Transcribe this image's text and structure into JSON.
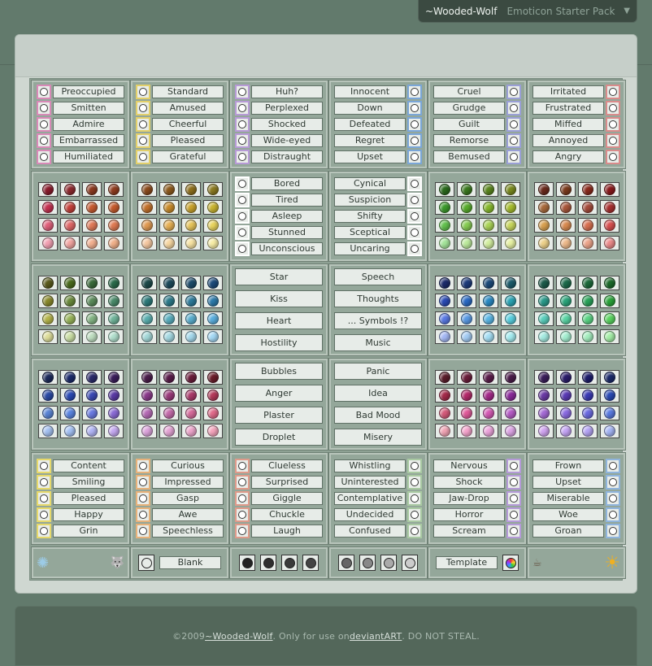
{
  "tab": {
    "user": "~Wooded-Wolf",
    "pack": "Emoticon Starter Pack"
  },
  "rows1": [
    {
      "labels": [
        "Preoccupied",
        "Smitten",
        "Admire",
        "Embarrassed",
        "Humiliated"
      ],
      "side": "left",
      "color": "#d889b7"
    },
    {
      "labels": [
        "Standard",
        "Amused",
        "Cheerful",
        "Pleased",
        "Grateful"
      ],
      "side": "left",
      "color": "#e2cf6a"
    },
    {
      "labels": [
        "Huh?",
        "Perplexed",
        "Shocked",
        "Wide-eyed",
        "Distraught"
      ],
      "side": "left",
      "color": "#b79ad6"
    },
    {
      "labels": [
        "Innocent",
        "Down",
        "Defeated",
        "Regret",
        "Upset"
      ],
      "side": "right",
      "color": "#7aa6d8"
    },
    {
      "labels": [
        "Cruel",
        "Grudge",
        "Guilt",
        "Remorse",
        "Bemused"
      ],
      "side": "right",
      "color": "#9a9fd6"
    },
    {
      "labels": [
        "Irritated",
        "Frustrated",
        "Miffed",
        "Annoyed",
        "Angry"
      ],
      "side": "right",
      "color": "#d98b8b"
    }
  ],
  "rows3": [
    {
      "labels": [
        "Content",
        "Smiling",
        "Pleased",
        "Happy",
        "Grin"
      ],
      "side": "left",
      "color": "#e6d86a"
    },
    {
      "labels": [
        "Curious",
        "Impressed",
        "Gasp",
        "Awe",
        "Speechless"
      ],
      "side": "left",
      "color": "#e6b17a"
    },
    {
      "labels": [
        "Clueless",
        "Surprised",
        "Giggle",
        "Chuckle",
        "Laugh"
      ],
      "side": "left",
      "color": "#de9a8a"
    },
    {
      "labels": [
        "Whistling",
        "Uninterested",
        "Contemplative",
        "Undecided",
        "Confused"
      ],
      "side": "right",
      "color": "#a9c9a2"
    },
    {
      "labels": [
        "Nervous",
        "Shock",
        "Jaw-Drop",
        "Horror",
        "Scream"
      ],
      "side": "right",
      "color": "#b59ad8"
    },
    {
      "labels": [
        "Frown",
        "Upset",
        "Miserable",
        "Woe",
        "Groan"
      ],
      "side": "right",
      "color": "#8fb4dc"
    }
  ],
  "middle": {
    "sleepy": [
      "Bored",
      "Tired",
      "Asleep",
      "Stunned",
      "Unconscious"
    ],
    "sceptic": [
      "Cynical",
      "Suspicion",
      "Shifty",
      "Sceptical",
      "Uncaring"
    ],
    "left_extras": [
      "Star",
      "Kiss",
      "Heart",
      "Hostility",
      "Bubbles",
      "Anger",
      "Plaster",
      "Droplet"
    ],
    "right_extras": [
      "Speech",
      "Thoughts",
      "... Symbols !?",
      "Music",
      "Panic",
      "Idea",
      "Bad Mood",
      "Misery"
    ]
  },
  "orbs": {
    "p1": [
      [
        "#8a1c2c",
        "#8e2a2f",
        "#8c3a20",
        "#8f3c1f"
      ],
      [
        "#c43050",
        "#c4403b",
        "#c65a30",
        "#c55a2c"
      ],
      [
        "#e0607a",
        "#e06868",
        "#e07a58",
        "#de7a52"
      ],
      [
        "#f2a0b2",
        "#f2a4a0",
        "#f2b090",
        "#f0b08a"
      ]
    ],
    "p2": [
      [
        "#8a4a1c",
        "#8d5a1d",
        "#8e6f1c",
        "#8b7a20"
      ],
      [
        "#c2702a",
        "#c88a2a",
        "#c9a22c",
        "#c9b430"
      ],
      [
        "#e09a52",
        "#e6b054",
        "#e6c45a",
        "#e8d45e"
      ],
      [
        "#f4c7a0",
        "#f6d6a0",
        "#f6e2a2",
        "#f6eca6"
      ]
    ],
    "p3": [
      [
        "#2a6a1c",
        "#3a781e",
        "#5a861e",
        "#7a8a1e"
      ],
      [
        "#3c9a2c",
        "#58ac2c",
        "#86b82c",
        "#a6bc2e"
      ],
      [
        "#62c04e",
        "#86cc52",
        "#aad456",
        "#c8d65c"
      ],
      [
        "#a4e49a",
        "#bcea9c",
        "#d2ee9e",
        "#e6f0a2"
      ]
    ],
    "p4": [
      [
        "#6a2a1c",
        "#7a3a1c",
        "#8a2a1c",
        "#8a1a1c"
      ],
      [
        "#a86a3c",
        "#a8563a",
        "#a44a3a",
        "#a83030"
      ],
      [
        "#d8a050",
        "#d88a50",
        "#d87050",
        "#d85050"
      ],
      [
        "#ecd08a",
        "#ecb88a",
        "#eca48a",
        "#ec8a8a"
      ]
    ],
    "p5": [
      [
        "#5a5a1c",
        "#4a6a1c",
        "#3a6a3a",
        "#2a6a4a"
      ],
      [
        "#8a8a2c",
        "#6a8a3c",
        "#5a8a5a",
        "#4a8a6a"
      ],
      [
        "#b4b44a",
        "#98b45a",
        "#84b484",
        "#70b49a"
      ],
      [
        "#dede9a",
        "#cadea4",
        "#bedec0",
        "#b0decc"
      ]
    ],
    "p6": [
      [
        "#1c4a4a",
        "#1c4a5a",
        "#1c4a6a",
        "#1c4a7a"
      ],
      [
        "#2c7a7a",
        "#2c7a8a",
        "#2c7a9a",
        "#2c7aaa"
      ],
      [
        "#5aaeae",
        "#5aaebe",
        "#5aaece",
        "#5aaede"
      ],
      [
        "#a4d8d8",
        "#a4d8e2",
        "#a4d8ec",
        "#a4d8f4"
      ]
    ],
    "p7": [
      [
        "#1c2a6a",
        "#1c3a7a",
        "#1c4a7a",
        "#1c5a6a"
      ],
      [
        "#2a4ab4",
        "#2a6ac4",
        "#2a8ac4",
        "#2aa4b4"
      ],
      [
        "#5a7ae4",
        "#5a9ae4",
        "#5ab6e4",
        "#5ad0e0"
      ],
      [
        "#a4b8f4",
        "#a4ccf4",
        "#a4def4",
        "#a4ecf0"
      ]
    ],
    "p8": [
      [
        "#1c5a4a",
        "#1c6a4a",
        "#1c6a3a",
        "#1c6a2a"
      ],
      [
        "#2a9a8a",
        "#2aa47a",
        "#2aa45a",
        "#2aa43a"
      ],
      [
        "#5acebc",
        "#5ad4a4",
        "#5ad484",
        "#5ad460"
      ],
      [
        "#a4eae0",
        "#a4eed0",
        "#a4eebe",
        "#a4eea6"
      ]
    ],
    "p9": [
      [
        "#1c2a5a",
        "#1c2a6a",
        "#2a2a6a",
        "#3a1c5a"
      ],
      [
        "#2a4aa4",
        "#2a4ab4",
        "#3a4ab4",
        "#5a3aa4"
      ],
      [
        "#5a84d4",
        "#5a84e0",
        "#6a7ae0",
        "#8a6ad4"
      ],
      [
        "#a4c0f0",
        "#a4c0f4",
        "#b0b4f4",
        "#c4a8f0"
      ]
    ],
    "p10": [
      [
        "#4a1c4a",
        "#5a1c4a",
        "#6a1c3a",
        "#6a1c2a"
      ],
      [
        "#8a3a8a",
        "#9a3a7a",
        "#aa3a6a",
        "#b43a5a"
      ],
      [
        "#b46ab4",
        "#c46aaa",
        "#d46a9a",
        "#e06a8a"
      ],
      [
        "#dca4dc",
        "#e4a4d4",
        "#eca4ca",
        "#f4a4bc"
      ]
    ],
    "p11": [
      [
        "#5a1c2a",
        "#6a1c3a",
        "#5a1c4a",
        "#4a1c4a"
      ],
      [
        "#a42a4a",
        "#b42a6a",
        "#a42a8a",
        "#8a2a9a"
      ],
      [
        "#d45a7a",
        "#e05a9a",
        "#d45ab4",
        "#b45ac4"
      ],
      [
        "#f0a4b4",
        "#f4a4cc",
        "#eca4dc",
        "#dca4e4"
      ]
    ],
    "p12": [
      [
        "#3a1c5a",
        "#2a1c6a",
        "#1c1c6a",
        "#1c2a6a"
      ],
      [
        "#6a3aa4",
        "#5a3ab4",
        "#3a3ab4",
        "#2a4ab4"
      ],
      [
        "#a46ad4",
        "#8a6ae0",
        "#6a6ae0",
        "#5a7ae0"
      ],
      [
        "#d0a4f0",
        "#c4a4f4",
        "#b4a4f4",
        "#a4b4f4"
      ]
    ]
  },
  "bottom": {
    "blank": "Blank",
    "template": "Template"
  },
  "footer": {
    "copy": "©2009 ",
    "author": "~Wooded-Wolf",
    "mid": ". Only for use on ",
    "site": "deviantART",
    "end": ". DO NOT STEAL."
  }
}
